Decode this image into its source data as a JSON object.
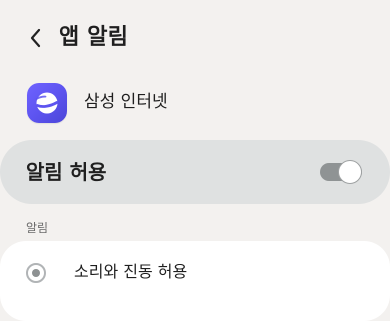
{
  "header": {
    "title": "앱 알림",
    "back_icon": "chevron-left-icon"
  },
  "app": {
    "name": "삼성 인터넷",
    "icon": "samsung-internet-icon",
    "brand_color": "#5d54f0"
  },
  "allow": {
    "label": "알림 허용",
    "enabled": true
  },
  "section": {
    "label": "알림"
  },
  "options": [
    {
      "label": "소리와 진동 허용",
      "selected": false
    }
  ]
}
